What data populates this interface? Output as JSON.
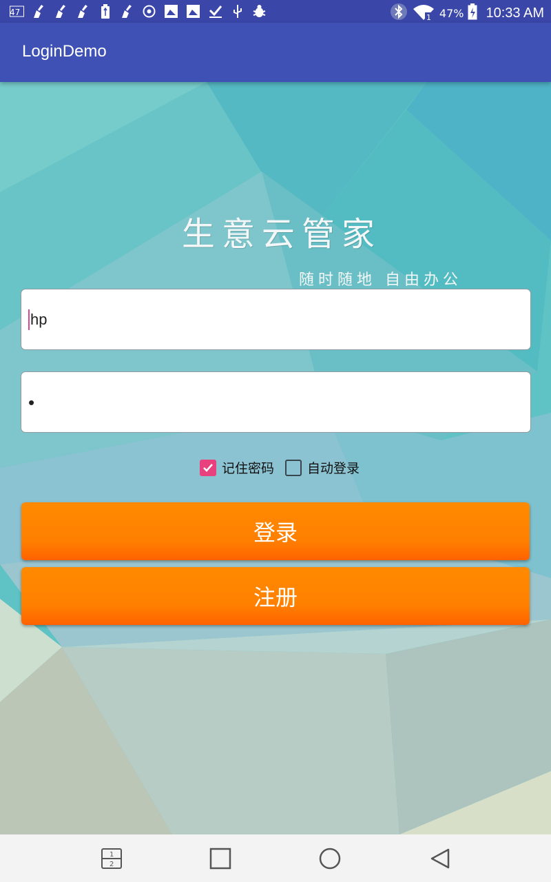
{
  "status_bar": {
    "battery_percent": "47%",
    "time": "10:33 AM",
    "left_icons": [
      "sim-icon",
      "broom-icon",
      "broom-icon",
      "broom-icon",
      "usb-battery-icon",
      "broom-icon",
      "settings-icon",
      "image-icon",
      "image-icon",
      "download-icon",
      "usb-icon",
      "bug-icon"
    ],
    "right_icons": [
      "bluetooth-icon",
      "wifi-icon",
      "battery-icon"
    ]
  },
  "app_bar": {
    "title": "LoginDemo"
  },
  "brand": {
    "title": "生意云管家",
    "subtitle": "随时随地 自由办公"
  },
  "form": {
    "username": {
      "value": "hp"
    },
    "password": {
      "masked_value": "•"
    },
    "remember_password": {
      "label": "记住密码",
      "checked": true
    },
    "auto_login": {
      "label": "自动登录",
      "checked": false
    },
    "login_label": "登录",
    "register_label": "注册"
  },
  "nav_bar": {
    "buttons": [
      "multi-window-icon",
      "recents-icon",
      "home-icon",
      "back-icon"
    ]
  },
  "colors": {
    "status_bar": "#3a46a8",
    "app_bar": "#3f51b5",
    "accent": "#e8417d",
    "button": "#ff8000"
  }
}
